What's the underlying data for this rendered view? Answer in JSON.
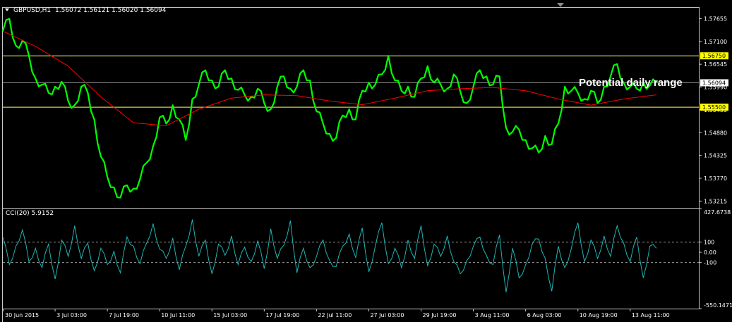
{
  "header": {
    "symbol_timeframe": "GBPUSD,H1",
    "ohlc": "1.56072 1.56121 1.56020 1.56094",
    "indicator": "CCI(20) 5.9152"
  },
  "annotation": "Potential daily range",
  "colors": {
    "background": "#000000",
    "frame": "#c8c8c8",
    "price": "#00ff00",
    "ma": "#ff0000",
    "level_lines": "#ffff66",
    "label_bg": "#ffff00",
    "current_line": "#8c8c8c",
    "cci": "#1fb5b5",
    "cci_levels": "#9a9a9a"
  },
  "chart_data": [
    {
      "type": "line",
      "name": "price-panel",
      "y_ticks": [
        "1.57655",
        "1.57100",
        "1.56545",
        "1.55990",
        "1.55435",
        "1.54880",
        "1.54325",
        "1.53770",
        "1.53215"
      ],
      "ylim": [
        1.5305,
        1.5792
      ],
      "x_labels": [
        "30 Jun 2015",
        "3 Jul 03:00",
        "7 Jul 19:00",
        "10 Jul 11:00",
        "15 Jul 03:00",
        "17 Jul 19:00",
        "22 Jul 11:00",
        "27 Jul 03:00",
        "29 Jul 19:00",
        "3 Aug 11:00",
        "6 Aug 03:00",
        "10 Aug 19:00",
        "13 Aug 11:00"
      ],
      "levels": [
        {
          "value": 1.5675,
          "label": "1.56750"
        },
        {
          "value": 1.555,
          "label": "1.55500"
        }
      ],
      "current": {
        "value": 1.56094,
        "label": "1.56094"
      },
      "series": [
        {
          "role": "price",
          "x": [
            0,
            2,
            4,
            6,
            8,
            10,
            12,
            14,
            16,
            18,
            20,
            22,
            24,
            26,
            28,
            30,
            32,
            34,
            36,
            38,
            40,
            42,
            44,
            46,
            48,
            50,
            52,
            54,
            56,
            58,
            60,
            62,
            64,
            66,
            68,
            70,
            72,
            74,
            76,
            78,
            80,
            82,
            84,
            86,
            88,
            90,
            92,
            94,
            96,
            98,
            100,
            102,
            104,
            106,
            108,
            110,
            112,
            114,
            116,
            118,
            120,
            122,
            124,
            126,
            128,
            130,
            132,
            134,
            136,
            138,
            140,
            142,
            144,
            146,
            148,
            150,
            152,
            154,
            156,
            158,
            160,
            162,
            164,
            166,
            168,
            170,
            172,
            174,
            176,
            178,
            180,
            182,
            184,
            186,
            188,
            190,
            192,
            194,
            196,
            198,
            200
          ],
          "values": [
            1.5735,
            1.5765,
            1.57,
            1.5712,
            1.5675,
            1.562,
            1.5605,
            1.5585,
            1.56,
            1.5612,
            1.5565,
            1.5555,
            1.56,
            1.5585,
            1.552,
            1.543,
            1.538,
            1.5355,
            1.533,
            1.536,
            1.5352,
            1.5375,
            1.5415,
            1.5455,
            1.5525,
            1.551,
            1.5555,
            1.552,
            1.547,
            1.557,
            1.5605,
            1.564,
            1.5615,
            1.56,
            1.564,
            1.562,
            1.5592,
            1.558,
            1.5575,
            1.5595,
            1.556,
            1.5545,
            1.56,
            1.5625,
            1.5595,
            1.56,
            1.564,
            1.5615,
            1.554,
            1.551,
            1.5485,
            1.5475,
            1.553,
            1.5545,
            1.552,
            1.559,
            1.561,
            1.5605,
            1.563,
            1.5675,
            1.5615,
            1.559,
            1.56,
            1.5575,
            1.562,
            1.565,
            1.561,
            1.5605,
            1.5595,
            1.563,
            1.5588,
            1.556,
            1.56,
            1.564,
            1.5625,
            1.5605,
            1.5625,
            1.55,
            1.549,
            1.5495,
            1.547,
            1.545,
            1.544,
            1.548,
            1.546,
            1.551,
            1.56,
            1.559,
            1.5585,
            1.557,
            1.559,
            1.556,
            1.56,
            1.5625,
            1.5655,
            1.561,
            1.56,
            1.5595,
            1.561,
            1.5603,
            1.5609
          ]
        },
        {
          "role": "moving-average",
          "x": [
            0,
            10,
            20,
            30,
            40,
            50,
            60,
            70,
            80,
            90,
            100,
            110,
            120,
            130,
            140,
            150,
            160,
            170,
            180,
            190,
            200
          ],
          "values": [
            1.5735,
            1.5698,
            1.565,
            1.5575,
            1.5512,
            1.5505,
            1.5545,
            1.5572,
            1.558,
            1.5578,
            1.5565,
            1.5556,
            1.5572,
            1.559,
            1.5595,
            1.5598,
            1.559,
            1.557,
            1.5555,
            1.557,
            1.558
          ]
        }
      ]
    },
    {
      "type": "line",
      "name": "cci-panel",
      "y_ticks": [
        "427.6738",
        "100",
        "0.00",
        "-100",
        "-550.1471"
      ],
      "ylim": [
        -550.1471,
        427.6738
      ],
      "levels": [
        100,
        -100
      ],
      "series": [
        {
          "role": "cci",
          "x": [
            0,
            2,
            4,
            6,
            8,
            10,
            12,
            14,
            16,
            18,
            20,
            22,
            24,
            26,
            28,
            30,
            32,
            34,
            36,
            38,
            40,
            42,
            44,
            46,
            48,
            50,
            52,
            54,
            56,
            58,
            60,
            62,
            64,
            66,
            68,
            70,
            72,
            74,
            76,
            78,
            80,
            82,
            84,
            86,
            88,
            90,
            92,
            94,
            96,
            98,
            100,
            102,
            104,
            106,
            108,
            110,
            112,
            114,
            116,
            118,
            120,
            122,
            124,
            126,
            128,
            130,
            132,
            134,
            136,
            138,
            140,
            142,
            144,
            146,
            148,
            150,
            152,
            154,
            156,
            158,
            160,
            162,
            164,
            166,
            168,
            170,
            172,
            174,
            176,
            178,
            180,
            182,
            184,
            186,
            188,
            190,
            192,
            194,
            196,
            198,
            200
          ],
          "values": [
            150,
            -120,
            60,
            220,
            -90,
            40,
            -150,
            80,
            -260,
            120,
            -40,
            260,
            -60,
            90,
            -180,
            40,
            -120,
            10,
            -200,
            150,
            60,
            -110,
            90,
            280,
            30,
            -60,
            140,
            -170,
            60,
            320,
            -40,
            120,
            -210,
            80,
            -30,
            160,
            -120,
            50,
            -90,
            110,
            -160,
            230,
            -60,
            70,
            310,
            -200,
            40,
            -150,
            -40,
            120,
            -80,
            -140,
            60,
            180,
            -50,
            240,
            -190,
            60,
            290,
            -110,
            40,
            -150,
            120,
            -60,
            260,
            -130,
            80,
            -40,
            160,
            -90,
            -210,
            -80,
            60,
            150,
            -30,
            -120,
            170,
            -390,
            40,
            -250,
            -120,
            80,
            130,
            -60,
            -380,
            60,
            -150,
            40,
            290,
            -90,
            120,
            -60,
            160,
            -40,
            260,
            90,
            -90,
            150,
            -250,
            60,
            40
          ]
        }
      ]
    }
  ]
}
